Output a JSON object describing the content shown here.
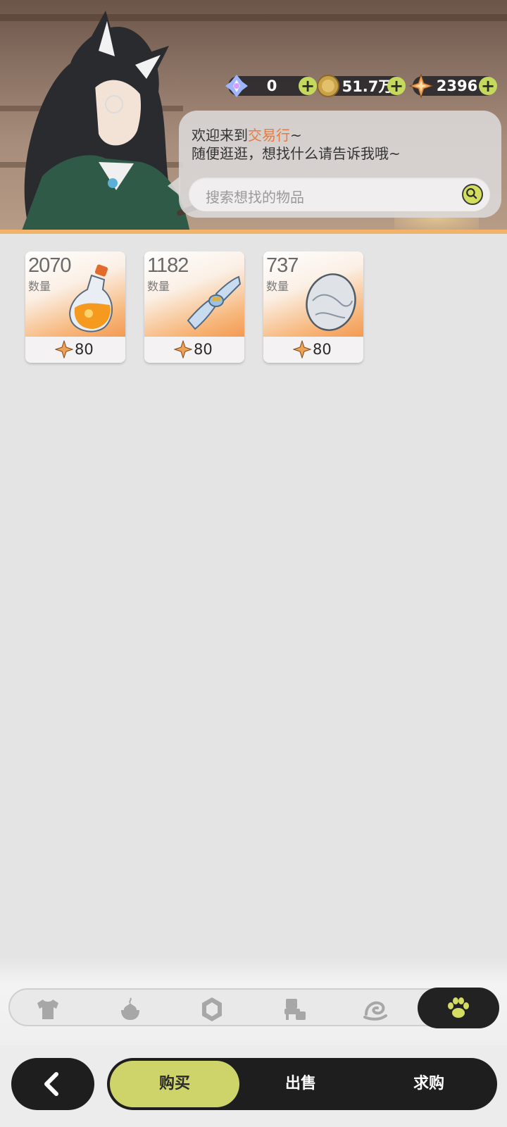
{
  "currencies": [
    {
      "icon": "crystal-icon",
      "value": "0"
    },
    {
      "icon": "gold-coin-icon",
      "value": "51.7万"
    },
    {
      "icon": "star-shard-icon",
      "value": "2396"
    }
  ],
  "greeting": {
    "line1_prefix": "欢迎来到",
    "line1_highlight": "交易行",
    "line1_suffix": "~",
    "line2": "随便逛逛，想找什么请告诉我哦~"
  },
  "search": {
    "placeholder": "搜索想找的物品"
  },
  "items": [
    {
      "quantity": "2070",
      "quantity_label": "数量",
      "price": "80",
      "icon": "potion-bottle-icon"
    },
    {
      "quantity": "1182",
      "quantity_label": "数量",
      "price": "80",
      "icon": "cloth-roll-icon"
    },
    {
      "quantity": "737",
      "quantity_label": "数量",
      "price": "80",
      "icon": "egg-icon"
    }
  ],
  "categories": [
    {
      "icon": "shirt-icon"
    },
    {
      "icon": "food-icon"
    },
    {
      "icon": "gem-icon"
    },
    {
      "icon": "furniture-icon"
    },
    {
      "icon": "swirl-icon"
    },
    {
      "icon": "paw-icon",
      "active": true
    }
  ],
  "nav": {
    "buy": "购买",
    "sell": "出售",
    "request": "求购"
  },
  "colors": {
    "accent": "#cfd46a",
    "highlight": "#e9793d",
    "dark": "#1e1e1e"
  }
}
